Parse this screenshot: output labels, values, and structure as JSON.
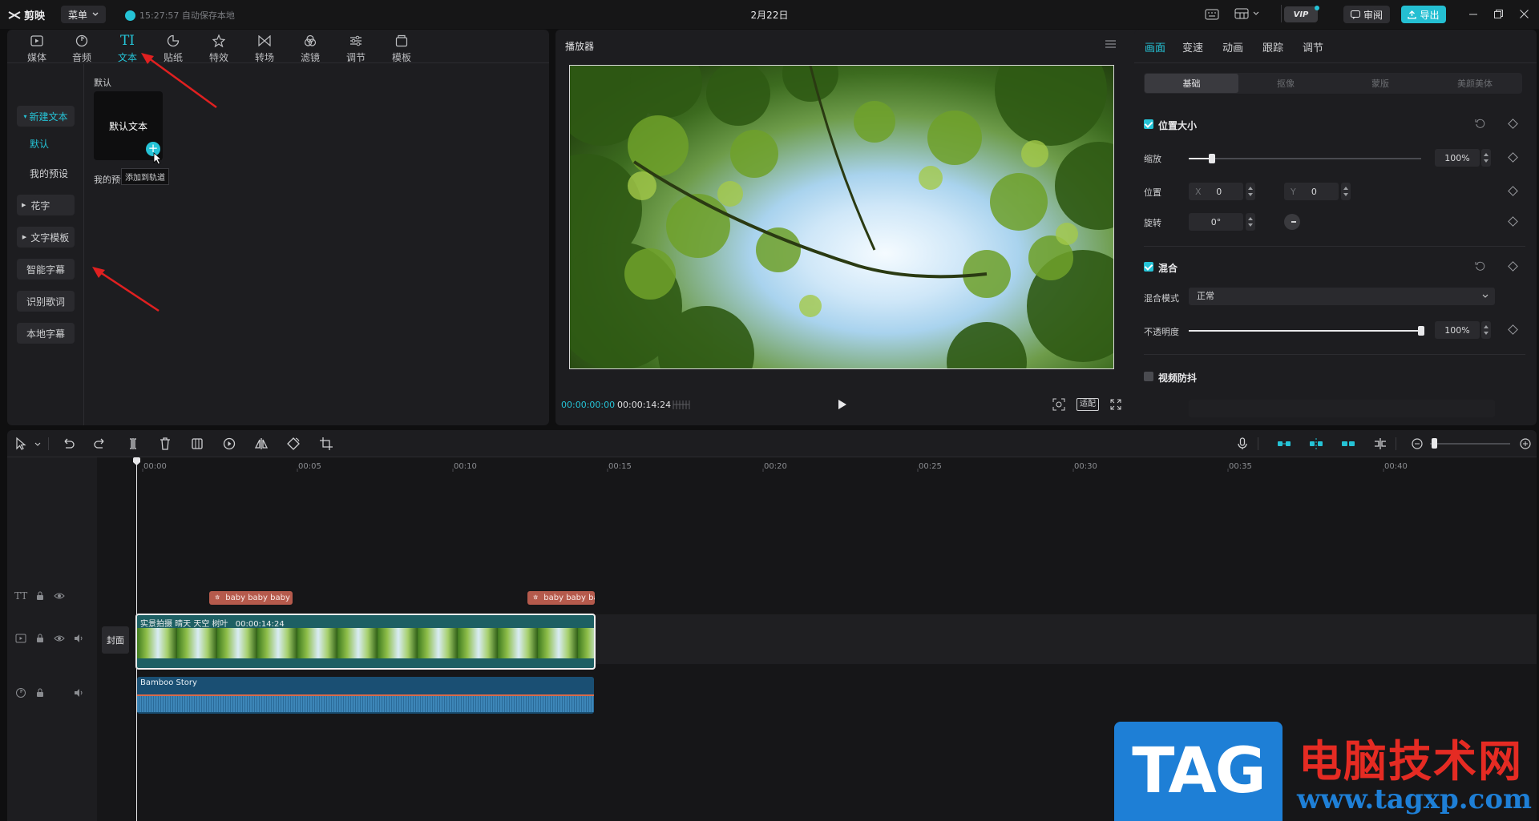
{
  "app": {
    "logo_text": "剪映",
    "menu_label": "菜单",
    "autosave_text": "15:27:57 自动保存本地",
    "window_title": "2月22日",
    "vip_label": "VIP",
    "review_label": "审阅",
    "export_label": "导出"
  },
  "toolbar": {
    "tabs": [
      {
        "label": "媒体",
        "icon": "media-icon"
      },
      {
        "label": "音频",
        "icon": "audio-icon"
      },
      {
        "label": "文本",
        "icon": "text-icon"
      },
      {
        "label": "贴纸",
        "icon": "sticker-icon"
      },
      {
        "label": "特效",
        "icon": "effects-icon"
      },
      {
        "label": "转场",
        "icon": "transition-icon"
      },
      {
        "label": "滤镜",
        "icon": "filter-icon"
      },
      {
        "label": "调节",
        "icon": "adjust-icon"
      },
      {
        "label": "模板",
        "icon": "template-icon"
      }
    ],
    "active_tab": "文本"
  },
  "text_panel": {
    "side": {
      "new_text": "新建文本",
      "default": "默认",
      "my_presets": "我的预设",
      "fancy": "花字",
      "text_template": "文字模板",
      "smart_subtitle": "智能字幕",
      "lyrics": "识别歌词",
      "local_subtitle": "本地字幕"
    },
    "section_default": "默认",
    "card_label": "默认文本",
    "section_presets": "我的预设",
    "tooltip": "添加到轨道"
  },
  "player": {
    "title": "播放器",
    "current_time": "00:00:00:00",
    "total_time": "00:00:14:24",
    "ratio_label": "适配"
  },
  "inspector": {
    "tabs": [
      "画面",
      "变速",
      "动画",
      "跟踪",
      "调节"
    ],
    "subtabs": [
      "基础",
      "抠像",
      "蒙版",
      "美颜美体"
    ],
    "position_size": "位置大小",
    "scale_label": "缩放",
    "scale_value": "100%",
    "scale_fraction": 0.1,
    "position_label": "位置",
    "x_label": "X",
    "x_value": "0",
    "y_label": "Y",
    "y_value": "0",
    "rotate_label": "旋转",
    "rotate_value": "0°",
    "blend_label": "混合",
    "blend_mode_label": "混合模式",
    "blend_mode_value": "正常",
    "opacity_label": "不透明度",
    "opacity_value": "100%",
    "opacity_fraction": 1.0,
    "stabilize_label": "视频防抖"
  },
  "timeline": {
    "ruler_labels": [
      "00:00",
      "00:05",
      "00:10",
      "00:15",
      "00:20",
      "00:25",
      "00:30",
      "00:35",
      "00:40"
    ],
    "cover_label": "封面",
    "text_clip_1": "baby baby baby b",
    "text_clip_2": "baby baby ba",
    "video_clip_name": "实景拍摄 晴天 天空 树叶",
    "video_clip_duration": "00:00:14:24",
    "audio_clip_name": "Bamboo Story"
  },
  "watermark": {
    "tag": "TAG",
    "title": "电脑技术网",
    "url": "www.tagxp.com"
  },
  "colors": {
    "accent": "#25c3d6",
    "text_clip": "#b55a4c",
    "video_clip": "#1d5f63",
    "audio_clip": "#1a4f73"
  }
}
